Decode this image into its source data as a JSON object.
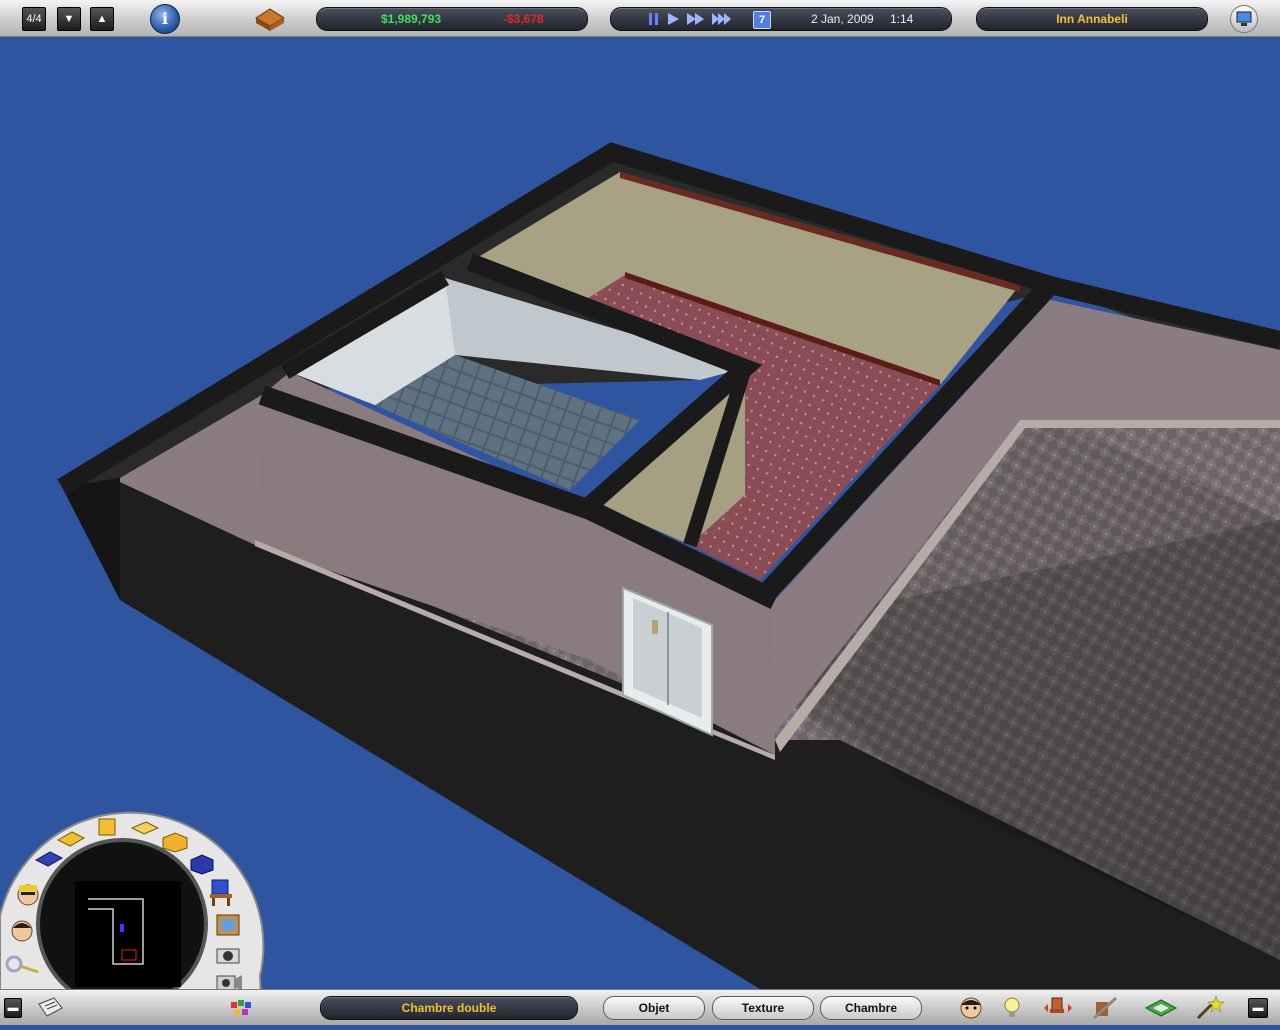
{
  "topbar": {
    "floor_indicator": "4/4",
    "money": "$1,989,793",
    "expense": "-$3,678",
    "speed_multiplier": "7",
    "date": "2 Jan, 2009",
    "time": "1:14",
    "hotel_name": "Inn Annabeli"
  },
  "bottombar": {
    "room_type": "Chambre double",
    "tabs": [
      "Objet",
      "Texture",
      "Chambre"
    ]
  },
  "colors": {
    "money_green": "#3fe05a",
    "expense_red": "#e02a1e",
    "hotel_name_yellow": "#f2c230",
    "room_type_yellow": "#f2c230",
    "background_blue": "#2f55a0"
  },
  "icons": {
    "top": [
      "floor-indicator",
      "down-arrow-icon",
      "up-arrow-icon",
      "info-icon",
      "hotel-icon",
      "pause-icon",
      "play-icon",
      "fast-forward-icon",
      "fastest-icon",
      "calendar-icon",
      "monitor-icon"
    ],
    "bottom": [
      "newspaper-icon",
      "palette-icon",
      "face-icon",
      "lightbulb-icon",
      "chair-icon",
      "tools-icon",
      "floor-tile-icon",
      "wand-icon",
      "minimize-icon"
    ],
    "dial": [
      "floor-tool-icon",
      "wall-tool-icon",
      "room-tool-icon",
      "staff-icon",
      "guest-icon",
      "keys-icon",
      "furniture-icon",
      "picture-icon",
      "camera-icon",
      "video-camera-icon"
    ]
  }
}
